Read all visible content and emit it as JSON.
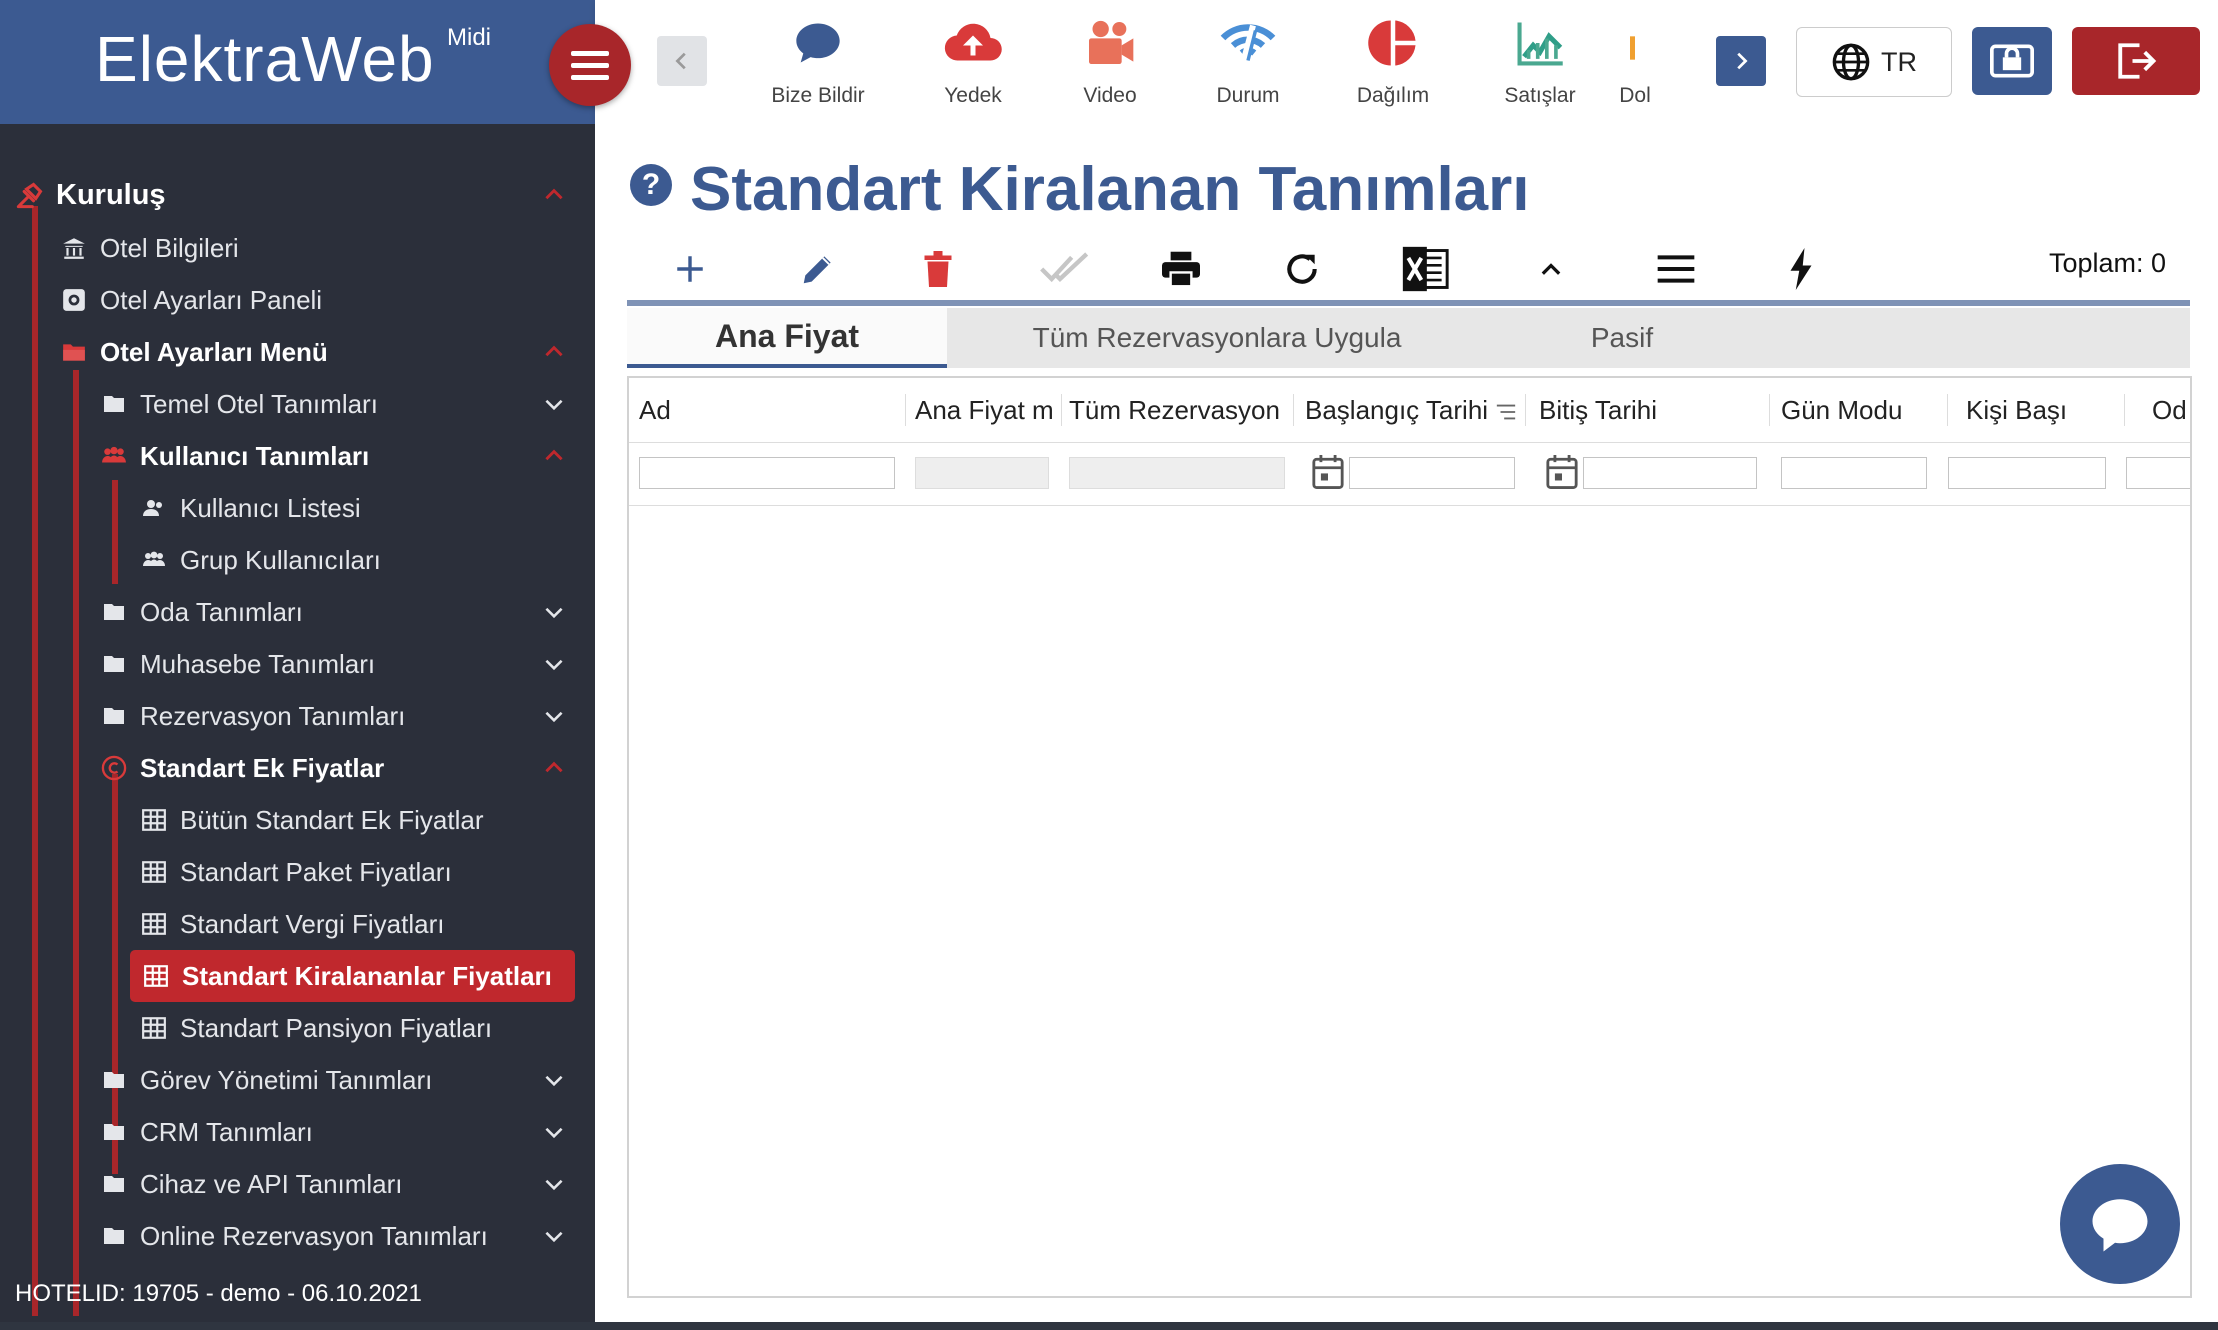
{
  "brand": {
    "name": "ElektraWeb",
    "edition": "Midi"
  },
  "toolbar": {
    "items": [
      {
        "label": "Bize Bildir",
        "icon": "chat-icon"
      },
      {
        "label": "Yedek",
        "icon": "cloud-upload-icon"
      },
      {
        "label": "Video",
        "icon": "video-camera-icon"
      },
      {
        "label": "Durum",
        "icon": "wifi-signal-icon"
      },
      {
        "label": "Dağılım",
        "icon": "pie-chart-icon"
      },
      {
        "label": "Satışlar",
        "icon": "sales-chart-icon"
      },
      {
        "label": "Dol",
        "icon": "bar-chart-icon"
      }
    ],
    "language": "TR"
  },
  "sidebar": {
    "items": [
      {
        "label": "Kuruluş",
        "level": 0,
        "icon": "gavel-icon",
        "expanded": true
      },
      {
        "label": "Otel Bilgileri",
        "level": 1,
        "icon": "building-icon"
      },
      {
        "label": "Otel Ayarları Paneli",
        "level": 1,
        "icon": "settings-panel-icon"
      },
      {
        "label": "Otel Ayarları Menü",
        "level": 1,
        "icon": "folder-open-icon",
        "expanded": true
      },
      {
        "label": "Temel Otel Tanımları",
        "level": 2,
        "icon": "folder-icon"
      },
      {
        "label": "Kullanıcı Tanımları",
        "level": 2,
        "icon": "users-icon",
        "expanded": true
      },
      {
        "label": "Kullanıcı Listesi",
        "level": 3,
        "icon": "user-list-icon"
      },
      {
        "label": "Grup Kullanıcıları",
        "level": 3,
        "icon": "group-users-icon"
      },
      {
        "label": "Oda Tanımları",
        "level": 2,
        "icon": "folder-icon"
      },
      {
        "label": "Muhasebe Tanımları",
        "level": 2,
        "icon": "folder-icon"
      },
      {
        "label": "Rezervasyon Tanımları",
        "level": 2,
        "icon": "folder-icon"
      },
      {
        "label": "Standart Ek Fiyatlar",
        "level": 2,
        "icon": "copyright-icon",
        "expanded": true
      },
      {
        "label": "Bütün Standart Ek Fiyatlar",
        "level": 3,
        "icon": "table-icon"
      },
      {
        "label": "Standart Paket Fiyatları",
        "level": 3,
        "icon": "table-icon"
      },
      {
        "label": "Standart Vergi Fiyatları",
        "level": 3,
        "icon": "table-icon"
      },
      {
        "label": "Standart Kiralananlar Fiyatları",
        "level": 3,
        "icon": "table-icon",
        "active": true
      },
      {
        "label": "Standart Pansiyon Fiyatları",
        "level": 3,
        "icon": "table-icon"
      },
      {
        "label": "Görev Yönetimi Tanımları",
        "level": 2,
        "icon": "folder-icon"
      },
      {
        "label": "CRM Tanımları",
        "level": 2,
        "icon": "folder-icon"
      },
      {
        "label": "Cihaz ve API Tanımları",
        "level": 2,
        "icon": "folder-icon"
      },
      {
        "label": "Online Rezervasyon Tanımları",
        "level": 2,
        "icon": "folder-icon"
      }
    ],
    "status": "HOTELID: 19705 - demo - 06.10.2021"
  },
  "page": {
    "title": "Standart Kiralanan Tanımları",
    "total": "Toplam: 0",
    "tabs": [
      "Ana Fiyat",
      "Tüm Rezervasyonlara Uygula",
      "Pasif"
    ],
    "columns": [
      "Ad",
      "Ana Fiyat m",
      "Tüm Rezervasyonl",
      "Başlangıç Tarihi",
      "Bitiş Tarihi",
      "Gün Modu",
      "Kişi Başı",
      "Od"
    ]
  },
  "colors": {
    "brand_blue": "#3c5a91",
    "brand_red": "#a8262a",
    "sidebar_bg": "#2b2f3a"
  }
}
